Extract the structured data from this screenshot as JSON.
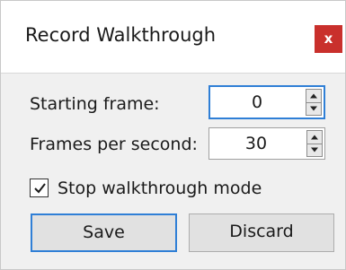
{
  "window": {
    "title": "Record Walkthrough",
    "close_label": "x"
  },
  "fields": {
    "starting_frame": {
      "label": "Starting frame:",
      "value": "0"
    },
    "frames_per_second": {
      "label": "Frames per second:",
      "value": "30"
    }
  },
  "options": {
    "stop_walkthrough_mode": {
      "label": "Stop walkthrough mode",
      "checked": true
    }
  },
  "buttons": {
    "save_label": "Save",
    "discard_label": "Discard"
  },
  "colors": {
    "close_button": "#c9302c",
    "focus_accent": "#2f7fd6",
    "body_background": "#f0f0f0"
  },
  "icons": {
    "close": "close-icon",
    "spin_up": "spin-up-icon",
    "spin_down": "spin-down-icon",
    "checkmark": "checkmark-icon"
  }
}
